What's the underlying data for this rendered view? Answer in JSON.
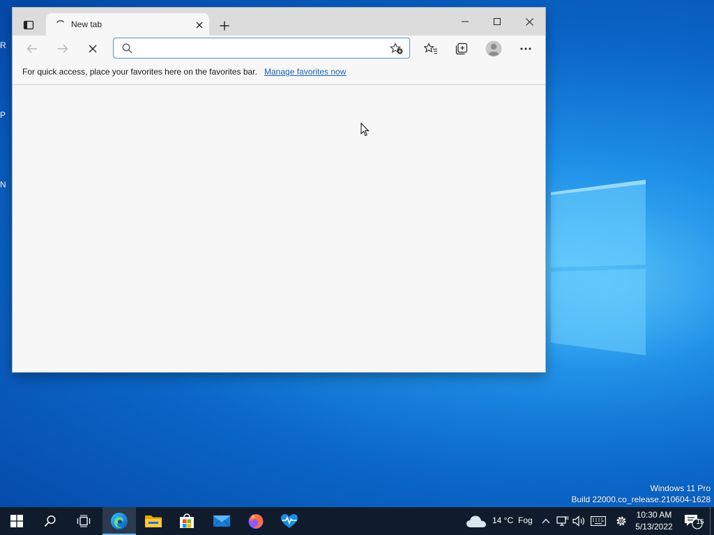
{
  "browser": {
    "tab": {
      "title": "New tab"
    },
    "address": {
      "value": "",
      "placeholder": ""
    },
    "favorites_bar": {
      "message": "For quick access, place your favorites here on the favorites bar.",
      "link": "Manage favorites now"
    }
  },
  "desktop": {
    "watermark": {
      "edition": "Windows 11 Pro",
      "build": "Build 22000.co_release.210604-1628"
    },
    "edge_icon_labels": [
      "R",
      "P",
      "N"
    ]
  },
  "taskbar": {
    "apps": [
      "start-icon",
      "search-icon",
      "task-view-icon",
      "edge-icon",
      "file-explorer-icon",
      "store-icon",
      "mail-icon",
      "firefox-icon",
      "health-icon"
    ],
    "weather": {
      "temperature": "14 °C",
      "condition": "Fog"
    },
    "clock": {
      "time": "10:30 AM",
      "date": "5/13/2022"
    },
    "notifications": {
      "count": "15"
    }
  },
  "colors": {
    "accent": "#1763b5",
    "taskbar": "#101c2c",
    "address_border": "#4d90d8"
  }
}
